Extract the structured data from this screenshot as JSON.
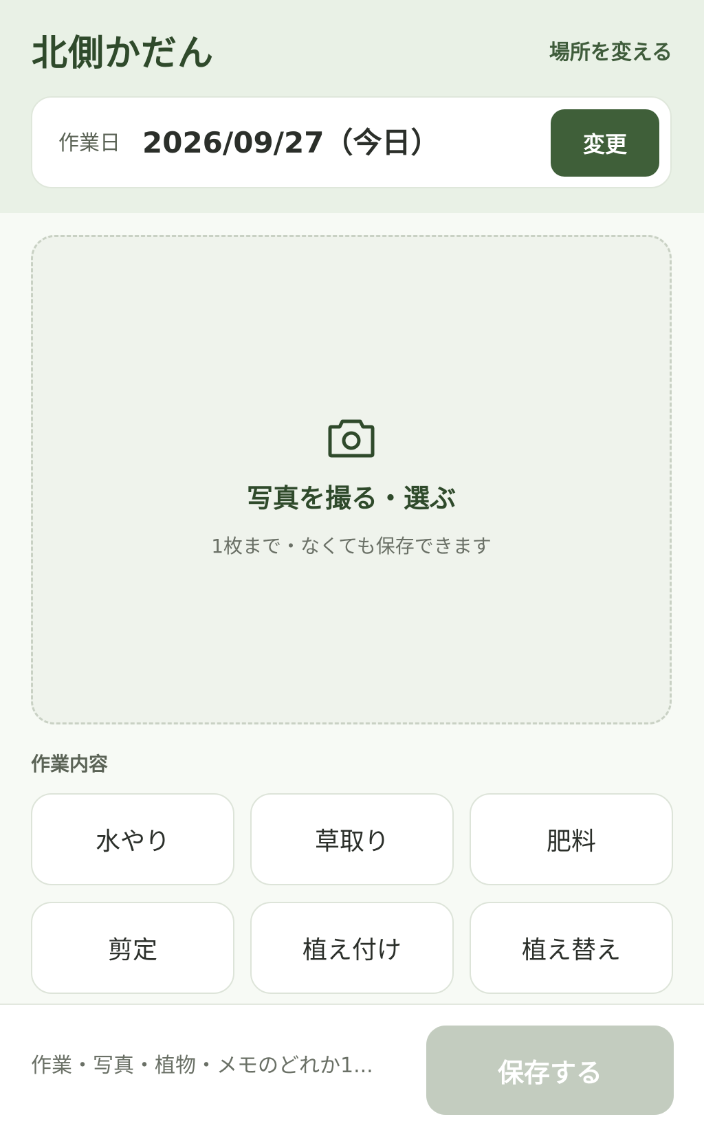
{
  "header": {
    "title": "北側かだん",
    "change_location_label": "場所を変える"
  },
  "date_card": {
    "label": "作業日",
    "value": "2026/09/27（今日）",
    "change_button_label": "変更"
  },
  "photo": {
    "icon": "camera-icon",
    "title": "写真を撮る・選ぶ",
    "hint": "1枚まで・なくても保存できます"
  },
  "tasks": {
    "section_label": "作業内容",
    "items": [
      {
        "label": "水やり"
      },
      {
        "label": "草取り"
      },
      {
        "label": "肥料"
      },
      {
        "label": "剪定"
      },
      {
        "label": "植え付け"
      },
      {
        "label": "植え替え"
      }
    ]
  },
  "footer": {
    "hint": "作業・写真・植物・メモのどれか1...",
    "save_button_label": "保存する",
    "save_button_disabled": true
  },
  "colors": {
    "accent": "#3f5f39",
    "header_bg": "#e9f1e6",
    "disabled_button": "#c3ccbf"
  }
}
